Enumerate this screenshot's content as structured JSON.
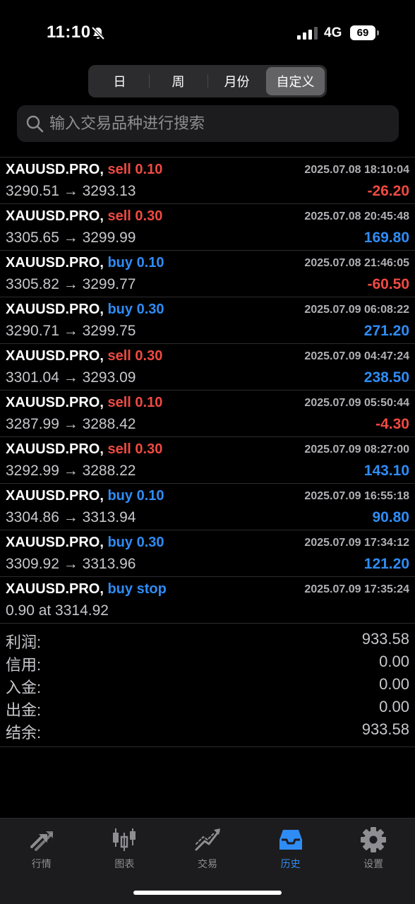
{
  "status": {
    "time": "11:10",
    "network": "4G",
    "battery": "69"
  },
  "period_tabs": [
    {
      "label": "日",
      "active": false
    },
    {
      "label": "周",
      "active": false
    },
    {
      "label": "月份",
      "active": false
    },
    {
      "label": "自定义",
      "active": true
    }
  ],
  "search": {
    "placeholder": "输入交易品种进行搜索"
  },
  "deals": [
    {
      "symbol": "XAUUSD.PRO,",
      "side": "sell 0.10",
      "type": "sell",
      "time": "2025.07.08 18:10:04",
      "detail": "3290.51 → 3293.13",
      "profit": "-26.20",
      "sign": "neg"
    },
    {
      "symbol": "XAUUSD.PRO,",
      "side": "sell 0.30",
      "type": "sell",
      "time": "2025.07.08 20:45:48",
      "detail": "3305.65 → 3299.99",
      "profit": "169.80",
      "sign": "pos"
    },
    {
      "symbol": "XAUUSD.PRO,",
      "side": "buy 0.10",
      "type": "buy",
      "time": "2025.07.08 21:46:05",
      "detail": "3305.82 → 3299.77",
      "profit": "-60.50",
      "sign": "neg"
    },
    {
      "symbol": "XAUUSD.PRO,",
      "side": "buy 0.30",
      "type": "buy",
      "time": "2025.07.09 06:08:22",
      "detail": "3290.71 → 3299.75",
      "profit": "271.20",
      "sign": "pos"
    },
    {
      "symbol": "XAUUSD.PRO,",
      "side": "sell 0.30",
      "type": "sell",
      "time": "2025.07.09 04:47:24",
      "detail": "3301.04 → 3293.09",
      "profit": "238.50",
      "sign": "pos"
    },
    {
      "symbol": "XAUUSD.PRO,",
      "side": "sell 0.10",
      "type": "sell",
      "time": "2025.07.09 05:50:44",
      "detail": "3287.99 → 3288.42",
      "profit": "-4.30",
      "sign": "neg"
    },
    {
      "symbol": "XAUUSD.PRO,",
      "side": "sell 0.30",
      "type": "sell",
      "time": "2025.07.09 08:27:00",
      "detail": "3292.99 → 3288.22",
      "profit": "143.10",
      "sign": "pos"
    },
    {
      "symbol": "XAUUSD.PRO,",
      "side": "buy 0.10",
      "type": "buy",
      "time": "2025.07.09 16:55:18",
      "detail": "3304.86 → 3313.94",
      "profit": "90.80",
      "sign": "pos"
    },
    {
      "symbol": "XAUUSD.PRO,",
      "side": "buy 0.30",
      "type": "buy",
      "time": "2025.07.09 17:34:12",
      "detail": "3309.92 → 3313.96",
      "profit": "121.20",
      "sign": "pos"
    },
    {
      "symbol": "XAUUSD.PRO,",
      "side": "buy stop",
      "type": "buy",
      "time": "2025.07.09 17:35:24",
      "detail": "0.90 at 3314.92",
      "profit": "",
      "sign": "pos"
    }
  ],
  "summary": [
    {
      "label": "利润:",
      "value": "933.58"
    },
    {
      "label": "信用:",
      "value": "0.00"
    },
    {
      "label": "入金:",
      "value": "0.00"
    },
    {
      "label": "出金:",
      "value": "0.00"
    },
    {
      "label": "结余:",
      "value": "933.58"
    }
  ],
  "tabbar": [
    {
      "label": "行情",
      "icon": "quotes-arrows-icon",
      "active": false
    },
    {
      "label": "图表",
      "icon": "candlestick-chart-icon",
      "active": false
    },
    {
      "label": "交易",
      "icon": "trade-trend-icon",
      "active": false
    },
    {
      "label": "历史",
      "icon": "history-inbox-icon",
      "active": true
    },
    {
      "label": "设置",
      "icon": "gear-icon",
      "active": false
    }
  ],
  "colors": {
    "sell": "#ef4a42",
    "buy": "#2f8cf5",
    "active_tab": "#2f8cf5"
  }
}
